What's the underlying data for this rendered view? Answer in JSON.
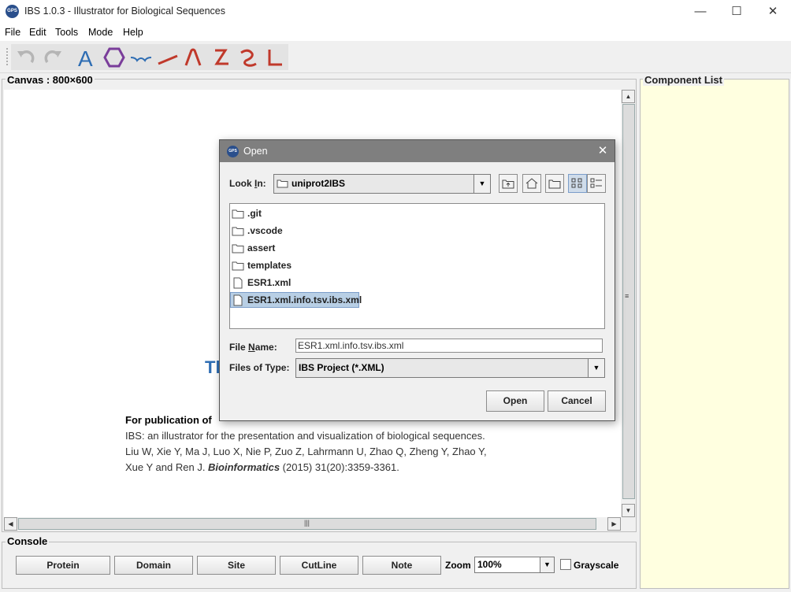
{
  "window": {
    "icon_text": "GPS",
    "title": "IBS 1.0.3 - Illustrator for Biological Sequences",
    "minimize": "—",
    "maximize": "☐",
    "close": "✕"
  },
  "menu": {
    "items": [
      "File",
      "Edit",
      "Tools",
      "Mode",
      "Help"
    ]
  },
  "toolbar": {
    "tools": [
      "undo-icon",
      "redo-icon",
      "text-tool-icon",
      "hexagon-tool-icon",
      "curly-bracket-tool-icon",
      "line-tool-icon",
      "arch-tool-icon",
      "z-shape-tool-icon",
      "wave-tool-icon",
      "l-shape-tool-icon"
    ],
    "accent": "#2e6db3",
    "tool_red": "#c0392b",
    "tool_purple": "#7a3d9a"
  },
  "canvas": {
    "title": "Canvas : 800×600",
    "partial_heading": "Th",
    "pub_heading": "For publication of",
    "pub_lines": [
      "IBS: an illustrator for the presentation and visualization of biological sequences.",
      "Liu W, Xie Y, Ma J, Luo X, Nie P, Zuo Z, Lahrmann U, Zhao Q, Zheng Y, Zhao Y,",
      "Xue Y and Ren J. ",
      "Bioinformatics",
      " (2015) 31(20):3359-3361."
    ]
  },
  "component_list": {
    "title": "Component List",
    "background": "#ffffe0"
  },
  "console": {
    "title": "Console",
    "buttons": [
      "Protein",
      "Domain",
      "Site",
      "CutLine",
      "Note"
    ],
    "zoom_label": "Zoom",
    "zoom_value": "100%",
    "grayscale_label": "Grayscale"
  },
  "dialog": {
    "icon_text": "GPS",
    "title": "Open",
    "close": "✕",
    "look_in_label_pre": "Look ",
    "look_in_label_key": "I",
    "look_in_label_post": "n:",
    "look_in_value": "uniprot2IBS",
    "files": [
      {
        "name": ".git",
        "type": "folder"
      },
      {
        "name": ".vscode",
        "type": "folder"
      },
      {
        "name": "assert",
        "type": "folder"
      },
      {
        "name": "templates",
        "type": "folder"
      },
      {
        "name": "ESR1.xml",
        "type": "file"
      },
      {
        "name": "ESR1.xml.info.tsv.ibs.xml",
        "type": "file",
        "selected": true
      }
    ],
    "file_name_label_pre": "File ",
    "file_name_label_key": "N",
    "file_name_label_post": "ame:",
    "file_name_value": "ESR1.xml.info.tsv.ibs.xml",
    "file_type_label": "Files of Type:",
    "file_type_value": "IBS Project (*.XML)",
    "open_button": "Open",
    "cancel_button": "Cancel"
  }
}
